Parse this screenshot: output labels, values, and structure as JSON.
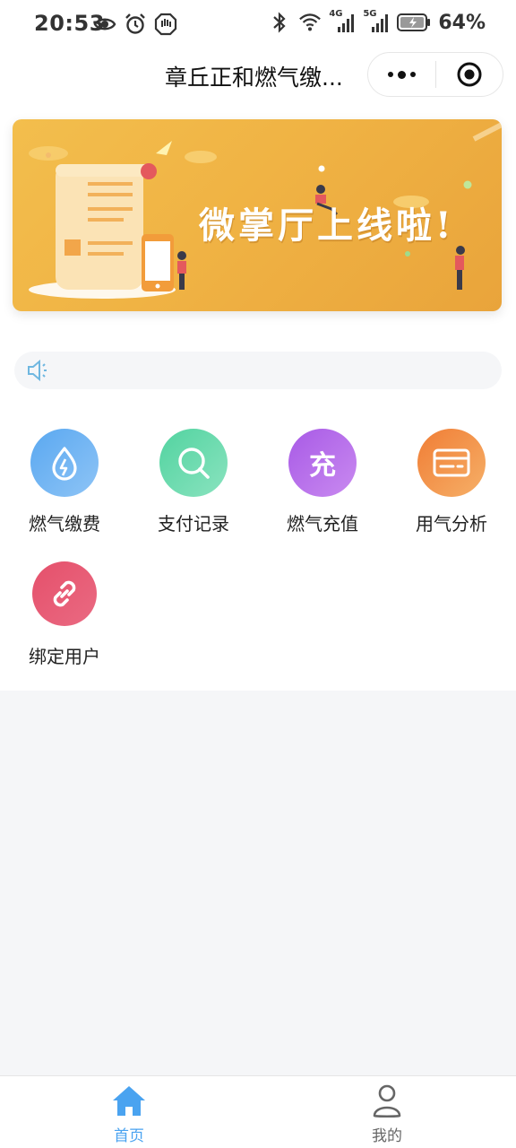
{
  "status_bar": {
    "time": "20:53",
    "battery": "64%",
    "network_labels": [
      "4G",
      "5G"
    ]
  },
  "header": {
    "title": "章丘正和燃气缴..."
  },
  "banner": {
    "headline": "微掌厅上线啦!"
  },
  "notice": {
    "text": ""
  },
  "menu": {
    "items": [
      {
        "label": "燃气缴费",
        "icon": "gas-drop-icon",
        "color_from": "#5aa8f0",
        "color_to": "#8ec4f6"
      },
      {
        "label": "支付记录",
        "icon": "search-icon",
        "color_from": "#52d3a0",
        "color_to": "#8ae3bf"
      },
      {
        "label": "燃气充值",
        "icon": "recharge-icon",
        "icon_text": "充",
        "color_from": "#a85ae6",
        "color_to": "#c98af0"
      },
      {
        "label": "用气分析",
        "icon": "card-icon",
        "color_from": "#f07d35",
        "color_to": "#f6b068"
      },
      {
        "label": "绑定用户",
        "icon": "link-icon",
        "color_from": "#e5506b",
        "color_to": "#ea6a82"
      }
    ]
  },
  "tab_bar": {
    "home_label": "首页",
    "mine_label": "我的",
    "active_color": "#4aa3f0",
    "inactive_color": "#666666"
  }
}
